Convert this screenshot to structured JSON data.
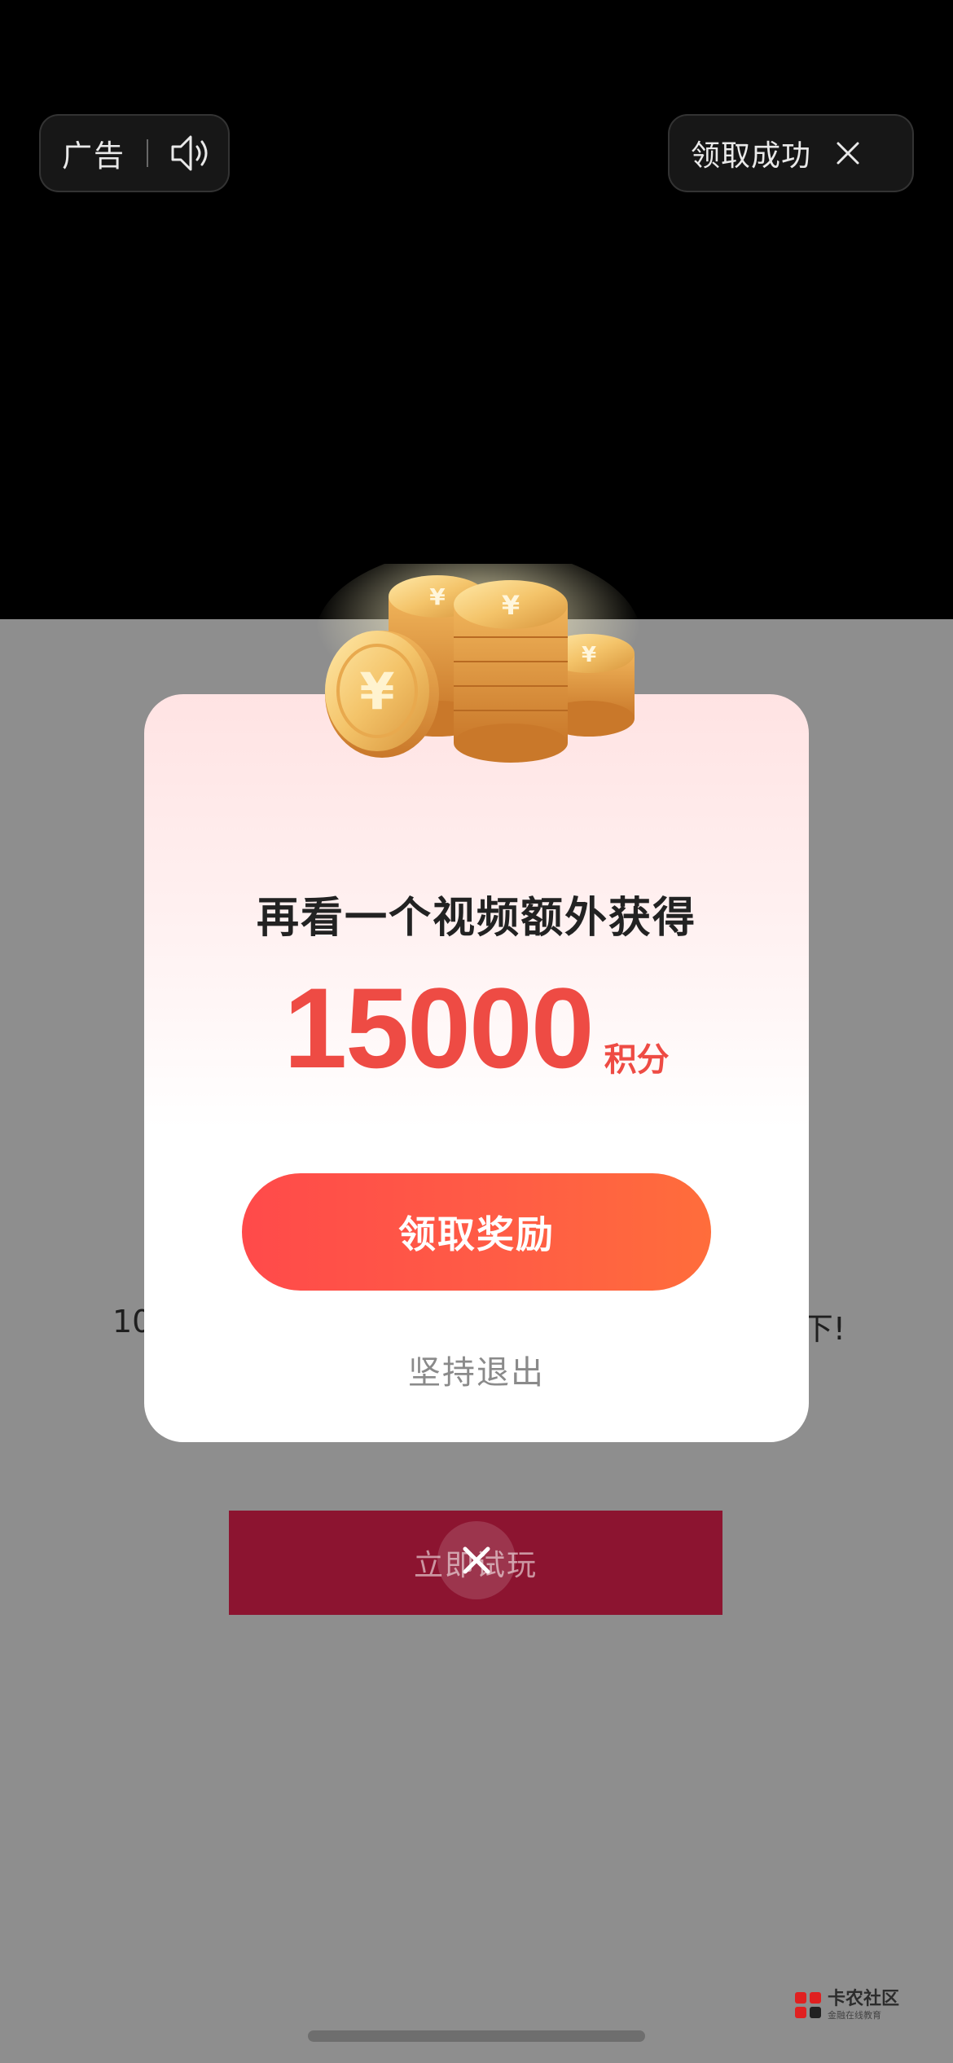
{
  "top_bar": {
    "ad_label": "广告",
    "speaker_icon": "speaker-icon",
    "success_label": "领取成功",
    "close_icon": "close-icon"
  },
  "background": {
    "desc_left": "10",
    "desc_right": "下!",
    "play_button_label": "立即试玩"
  },
  "dialog": {
    "title": "再看一个视频额外获得",
    "amount": "15000",
    "unit": "积分",
    "claim_button": "领取奖励",
    "quit_link": "坚持退出",
    "coins_icon": "gold-coins-icon"
  },
  "float_close_icon": "close-icon",
  "watermark": {
    "name": "卡农社区",
    "sub": "金融在线教育"
  },
  "colors": {
    "accent_red": "#ee4b44",
    "button_gradient_start": "#ff4a4a",
    "button_gradient_end": "#ff6d3b",
    "play_button": "#8c1430",
    "overlay_gray": "#8e8e8e"
  }
}
